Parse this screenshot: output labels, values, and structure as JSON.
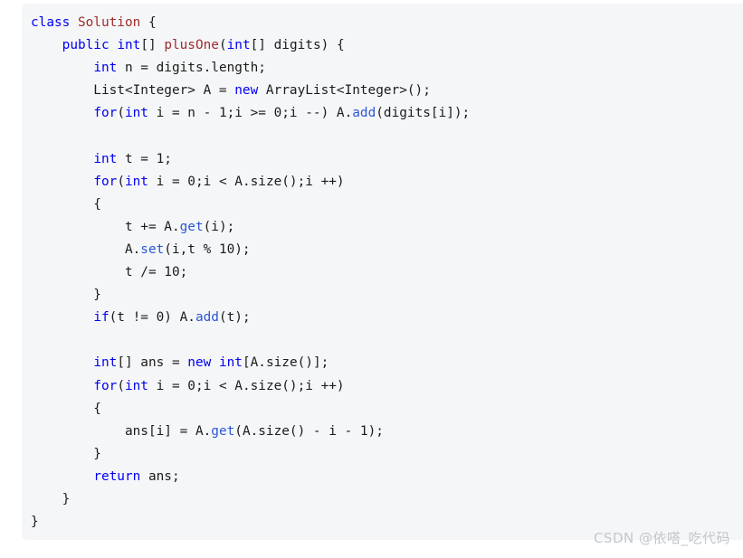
{
  "code_block": {
    "language": "java",
    "background_color": "#f5f6f8",
    "colors": {
      "keyword": "#0000f5",
      "type_name": "#a02c2c",
      "method_call": "#2b57d6",
      "plain": "#1b1b1b"
    },
    "lines": [
      [
        {
          "t": "class ",
          "c": "kw"
        },
        {
          "t": "Solution ",
          "c": "typ"
        },
        {
          "t": "{",
          "c": "pln"
        }
      ],
      [
        {
          "t": "    ",
          "c": "pln"
        },
        {
          "t": "public ",
          "c": "kw"
        },
        {
          "t": "int",
          "c": "kw"
        },
        {
          "t": "[] ",
          "c": "pln"
        },
        {
          "t": "plusOne",
          "c": "typ"
        },
        {
          "t": "(",
          "c": "pln"
        },
        {
          "t": "int",
          "c": "kw"
        },
        {
          "t": "[] digits) {",
          "c": "pln"
        }
      ],
      [
        {
          "t": "        ",
          "c": "pln"
        },
        {
          "t": "int",
          "c": "kw"
        },
        {
          "t": " n = digits.length;",
          "c": "pln"
        }
      ],
      [
        {
          "t": "        List<Integer> A = ",
          "c": "pln"
        },
        {
          "t": "new",
          "c": "kw"
        },
        {
          "t": " ArrayList<Integer>();",
          "c": "pln"
        }
      ],
      [
        {
          "t": "        ",
          "c": "pln"
        },
        {
          "t": "for",
          "c": "kw"
        },
        {
          "t": "(",
          "c": "pln"
        },
        {
          "t": "int",
          "c": "kw"
        },
        {
          "t": " i = n - 1;i >= 0;i --) A.",
          "c": "pln"
        },
        {
          "t": "add",
          "c": "mth"
        },
        {
          "t": "(digits[i]);",
          "c": "pln"
        }
      ],
      [],
      [
        {
          "t": "        ",
          "c": "pln"
        },
        {
          "t": "int",
          "c": "kw"
        },
        {
          "t": " t = 1;",
          "c": "pln"
        }
      ],
      [
        {
          "t": "        ",
          "c": "pln"
        },
        {
          "t": "for",
          "c": "kw"
        },
        {
          "t": "(",
          "c": "pln"
        },
        {
          "t": "int",
          "c": "kw"
        },
        {
          "t": " i = 0;i < A.size();i ++)",
          "c": "pln"
        }
      ],
      [
        {
          "t": "        {",
          "c": "pln"
        }
      ],
      [
        {
          "t": "            t += A.",
          "c": "pln"
        },
        {
          "t": "get",
          "c": "mth"
        },
        {
          "t": "(i);",
          "c": "pln"
        }
      ],
      [
        {
          "t": "            A.",
          "c": "pln"
        },
        {
          "t": "set",
          "c": "mth"
        },
        {
          "t": "(i,t % 10);",
          "c": "pln"
        }
      ],
      [
        {
          "t": "            t /= 10;",
          "c": "pln"
        }
      ],
      [
        {
          "t": "        }",
          "c": "pln"
        }
      ],
      [
        {
          "t": "        ",
          "c": "pln"
        },
        {
          "t": "if",
          "c": "kw"
        },
        {
          "t": "(t != 0) A.",
          "c": "pln"
        },
        {
          "t": "add",
          "c": "mth"
        },
        {
          "t": "(t);",
          "c": "pln"
        }
      ],
      [],
      [
        {
          "t": "        ",
          "c": "pln"
        },
        {
          "t": "int",
          "c": "kw"
        },
        {
          "t": "[] ans = ",
          "c": "pln"
        },
        {
          "t": "new",
          "c": "kw"
        },
        {
          "t": " ",
          "c": "pln"
        },
        {
          "t": "int",
          "c": "kw"
        },
        {
          "t": "[A.size()];",
          "c": "pln"
        }
      ],
      [
        {
          "t": "        ",
          "c": "pln"
        },
        {
          "t": "for",
          "c": "kw"
        },
        {
          "t": "(",
          "c": "pln"
        },
        {
          "t": "int",
          "c": "kw"
        },
        {
          "t": " i = 0;i < A.size();i ++)",
          "c": "pln"
        }
      ],
      [
        {
          "t": "        {",
          "c": "pln"
        }
      ],
      [
        {
          "t": "            ans[i] = A.",
          "c": "pln"
        },
        {
          "t": "get",
          "c": "mth"
        },
        {
          "t": "(A.size() - i - 1);",
          "c": "pln"
        }
      ],
      [
        {
          "t": "        }",
          "c": "pln"
        }
      ],
      [
        {
          "t": "        ",
          "c": "pln"
        },
        {
          "t": "return",
          "c": "kw"
        },
        {
          "t": " ans;",
          "c": "pln"
        }
      ],
      [
        {
          "t": "    }",
          "c": "pln"
        }
      ],
      [
        {
          "t": "}",
          "c": "pln"
        }
      ]
    ]
  },
  "watermark": {
    "text": "CSDN @依嗒_吃代码"
  }
}
